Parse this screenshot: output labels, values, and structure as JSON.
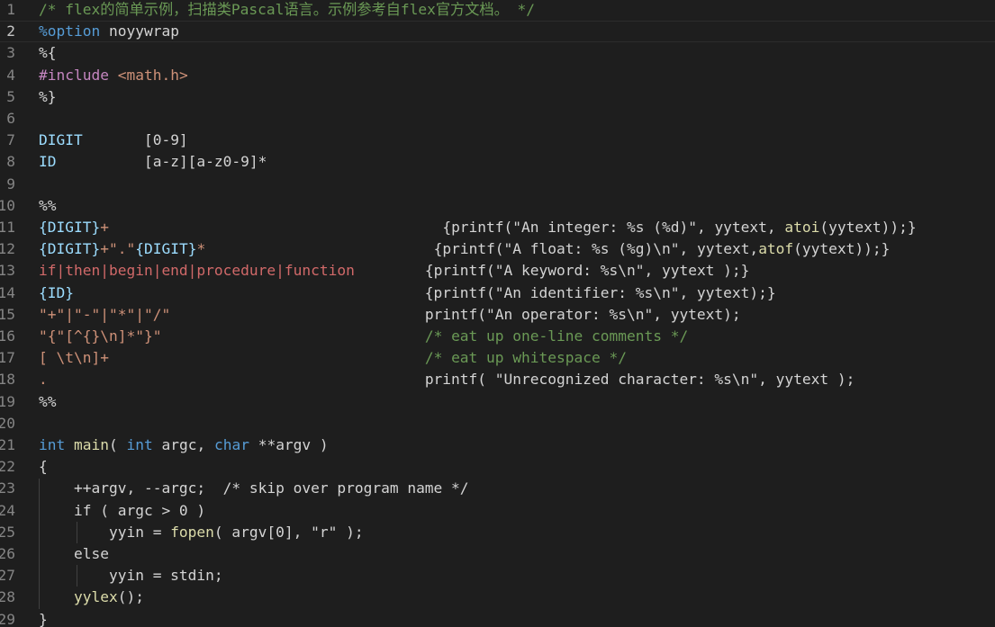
{
  "editor": {
    "theme_colors": {
      "background": "#1e1e1e",
      "comment": "#6a9955",
      "keyword": "#569cd6",
      "preprocessor": "#c586c0",
      "string": "#ce9178",
      "variable": "#9cdcfe",
      "function": "#dcdcaa",
      "regex": "#d16969",
      "line_number": "#858585"
    },
    "active_line": 2,
    "lines": [
      {
        "num": "1",
        "segments": [
          {
            "cls": "c-comment",
            "text": "/* flex的简单示例，扫描类Pascal语言。示例参考自flex官方文档。 */"
          }
        ]
      },
      {
        "num": "2",
        "segments": [
          {
            "cls": "c-keyword",
            "text": "%option"
          },
          {
            "cls": "c-plain",
            "text": " noyywrap"
          }
        ]
      },
      {
        "num": "3",
        "segments": [
          {
            "cls": "c-plain",
            "text": "%{"
          }
        ]
      },
      {
        "num": "4",
        "segments": [
          {
            "cls": "c-purple",
            "text": "#include"
          },
          {
            "cls": "c-plain",
            "text": " "
          },
          {
            "cls": "c-string",
            "text": "<math.h>"
          }
        ]
      },
      {
        "num": "5",
        "segments": [
          {
            "cls": "c-plain",
            "text": "%}"
          }
        ]
      },
      {
        "num": "6",
        "segments": []
      },
      {
        "num": "7",
        "segments": [
          {
            "cls": "c-var",
            "text": "DIGIT"
          },
          {
            "cls": "c-plain",
            "text": "       [0-9]"
          }
        ]
      },
      {
        "num": "8",
        "segments": [
          {
            "cls": "c-var",
            "text": "ID"
          },
          {
            "cls": "c-plain",
            "text": "          [a-z][a-z0-9]*"
          }
        ]
      },
      {
        "num": "9",
        "segments": []
      },
      {
        "num": "10",
        "segments": [
          {
            "cls": "c-plain",
            "text": "%%"
          }
        ]
      },
      {
        "num": "11",
        "segments": [
          {
            "cls": "c-var",
            "text": "{DIGIT}"
          },
          {
            "cls": "c-string",
            "text": "+"
          },
          {
            "cls": "c-plain",
            "text": "                                      {printf(\"An integer: %s (%d)\", yytext, "
          },
          {
            "cls": "c-func",
            "text": "atoi"
          },
          {
            "cls": "c-plain",
            "text": "(yytext));}"
          }
        ]
      },
      {
        "num": "12",
        "segments": [
          {
            "cls": "c-var",
            "text": "{DIGIT}"
          },
          {
            "cls": "c-string",
            "text": "+\".\""
          },
          {
            "cls": "c-var",
            "text": "{DIGIT}"
          },
          {
            "cls": "c-string",
            "text": "*"
          },
          {
            "cls": "c-plain",
            "text": "                          {printf(\"A float: %s (%g)\\n\", yytext,"
          },
          {
            "cls": "c-func",
            "text": "atof"
          },
          {
            "cls": "c-plain",
            "text": "(yytext));}"
          }
        ]
      },
      {
        "num": "13",
        "segments": [
          {
            "cls": "c-red",
            "text": "if|then|begin|end|procedure|function"
          },
          {
            "cls": "c-plain",
            "text": "        {printf(\"A keyword: %s\\n\", yytext );}"
          }
        ]
      },
      {
        "num": "14",
        "segments": [
          {
            "cls": "c-var",
            "text": "{ID}"
          },
          {
            "cls": "c-plain",
            "text": "                                        {printf(\"An identifier: %s\\n\", yytext);}"
          }
        ]
      },
      {
        "num": "15",
        "segments": [
          {
            "cls": "c-string",
            "text": "\"+\"|\"-\"|\"*\"|\"/\""
          },
          {
            "cls": "c-plain",
            "text": "                             printf(\"An operator: %s\\n\", yytext);"
          }
        ]
      },
      {
        "num": "16",
        "segments": [
          {
            "cls": "c-string",
            "text": "\"{\"[^{}\\n]*\"}\""
          },
          {
            "cls": "c-plain",
            "text": "                              "
          },
          {
            "cls": "c-comment",
            "text": "/* eat up one-line comments */"
          }
        ]
      },
      {
        "num": "17",
        "segments": [
          {
            "cls": "c-string",
            "text": "[ \\t\\n]+"
          },
          {
            "cls": "c-plain",
            "text": "                                    "
          },
          {
            "cls": "c-comment",
            "text": "/* eat up whitespace */"
          }
        ]
      },
      {
        "num": "18",
        "segments": [
          {
            "cls": "c-string",
            "text": "."
          },
          {
            "cls": "c-plain",
            "text": "                                           printf( \"Unrecognized character: %s\\n\", yytext );"
          }
        ]
      },
      {
        "num": "19",
        "segments": [
          {
            "cls": "c-plain",
            "text": "%%"
          }
        ]
      },
      {
        "num": "20",
        "segments": []
      },
      {
        "num": "21",
        "segments": [
          {
            "cls": "c-keyword",
            "text": "int"
          },
          {
            "cls": "c-plain",
            "text": " "
          },
          {
            "cls": "c-func",
            "text": "main"
          },
          {
            "cls": "c-plain",
            "text": "( "
          },
          {
            "cls": "c-keyword",
            "text": "int"
          },
          {
            "cls": "c-plain",
            "text": " argc, "
          },
          {
            "cls": "c-keyword",
            "text": "char"
          },
          {
            "cls": "c-plain",
            "text": " **argv )"
          }
        ]
      },
      {
        "num": "22",
        "segments": [
          {
            "cls": "c-plain",
            "text": "{"
          }
        ]
      },
      {
        "num": "23",
        "segments": [
          {
            "cls": "c-plain",
            "text": "    ++argv, --argc;  /* skip over program name */"
          }
        ]
      },
      {
        "num": "24",
        "segments": [
          {
            "cls": "c-plain",
            "text": "    if ( argc > 0 )"
          }
        ]
      },
      {
        "num": "25",
        "segments": [
          {
            "cls": "c-plain",
            "text": "        yyin = "
          },
          {
            "cls": "c-func",
            "text": "fopen"
          },
          {
            "cls": "c-plain",
            "text": "( argv[0], \"r\" );"
          }
        ]
      },
      {
        "num": "26",
        "segments": [
          {
            "cls": "c-plain",
            "text": "    else"
          }
        ]
      },
      {
        "num": "27",
        "segments": [
          {
            "cls": "c-plain",
            "text": "        yyin = stdin;"
          }
        ]
      },
      {
        "num": "28",
        "segments": [
          {
            "cls": "c-plain",
            "text": "    "
          },
          {
            "cls": "c-func",
            "text": "yylex"
          },
          {
            "cls": "c-plain",
            "text": "();"
          }
        ]
      },
      {
        "num": "29",
        "segments": [
          {
            "cls": "c-plain",
            "text": "}"
          }
        ]
      }
    ]
  }
}
